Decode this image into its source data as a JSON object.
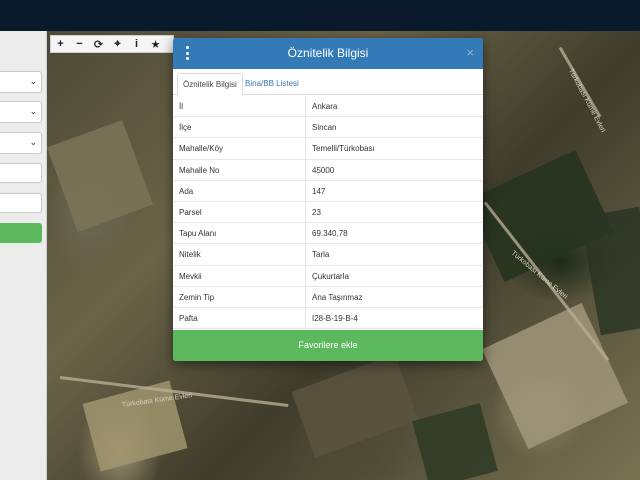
{
  "toolbar": {
    "buttons": [
      {
        "name": "zoom-in",
        "glyph": "+"
      },
      {
        "name": "zoom-out",
        "glyph": "−"
      },
      {
        "name": "refresh",
        "glyph": "⟳"
      },
      {
        "name": "locate",
        "glyph": "⌖"
      },
      {
        "name": "info",
        "glyph": "i"
      },
      {
        "name": "favorite",
        "glyph": "★"
      }
    ]
  },
  "modal": {
    "title": "Öznitelik Bilgisi",
    "close_glyph": "×",
    "tabs": [
      {
        "label": "Öznitelik Bilgisi",
        "active": true
      },
      {
        "label": "Bina/BB Listesi",
        "active": false
      }
    ],
    "rows": [
      {
        "key": "İl",
        "value": "Ankara"
      },
      {
        "key": "İlçe",
        "value": "Sincan"
      },
      {
        "key": "Mahalle/Köy",
        "value": "Temelli/Türkobası"
      },
      {
        "key": "Mahalle No",
        "value": "45000"
      },
      {
        "key": "Ada",
        "value": "147"
      },
      {
        "key": "Parsel",
        "value": "23"
      },
      {
        "key": "Tapu Alanı",
        "value": "69.340,78"
      },
      {
        "key": "Nitelik",
        "value": "Tarla"
      },
      {
        "key": "Mevkii",
        "value": "Çukurtarla"
      },
      {
        "key": "Zemin Tip",
        "value": "Ana Taşınmaz"
      },
      {
        "key": "Pafta",
        "value": "I28-B-19-B-4"
      }
    ],
    "favorite_button": "Favorilere ekle"
  },
  "map": {
    "labels": [
      "Türkobası Küme Evleri",
      "Türkobası Küme Evleri",
      "Türkobası Küme Evleri"
    ]
  },
  "colors": {
    "header": "#337ab7",
    "accent_green": "#5cb85c",
    "topbar": "#0a1a2a"
  }
}
